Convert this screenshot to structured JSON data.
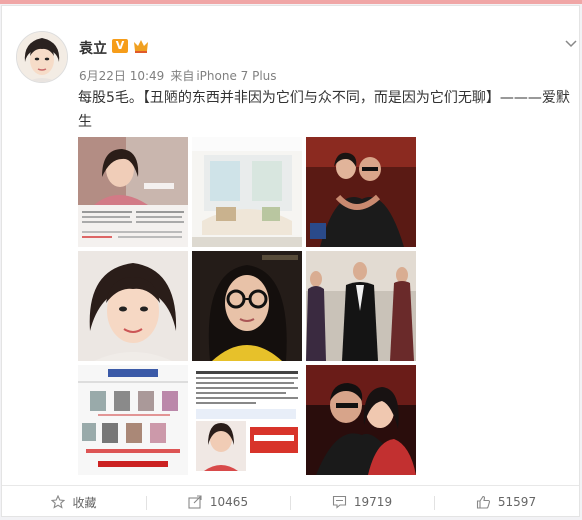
{
  "user": {
    "name": "袁立",
    "verified_badge": "V",
    "badge_color": "#f69d1a"
  },
  "post": {
    "date": "6月22日 10:49",
    "source_prefix": "来自",
    "source": "iPhone 7 Plus",
    "text_line1": "每股5毛。【丑陋的东西并非因为它们与众不同，而是因为它们无聊】———爱默",
    "text_line2": "生"
  },
  "images": [
    {
      "name": "image-1",
      "icon": "news-clipping-portrait"
    },
    {
      "name": "image-2",
      "icon": "interior-room"
    },
    {
      "name": "image-3",
      "icon": "couple-photo"
    },
    {
      "name": "image-4",
      "icon": "woman-portrait"
    },
    {
      "name": "image-5",
      "icon": "woman-glasses"
    },
    {
      "name": "image-6",
      "icon": "red-carpet-couple"
    },
    {
      "name": "image-7",
      "icon": "relationship-chart"
    },
    {
      "name": "image-8",
      "icon": "news-article"
    },
    {
      "name": "image-9",
      "icon": "couple-closeup"
    }
  ],
  "actions": {
    "favorite_label": "收藏",
    "repost_count": "10465",
    "comment_count": "19719",
    "like_count": "51597"
  }
}
